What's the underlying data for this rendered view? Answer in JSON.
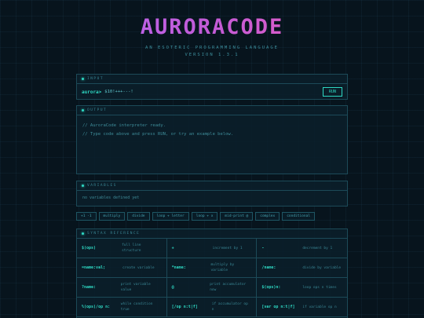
{
  "header": {
    "title": "AURORACODE",
    "tagline": "AN ESOTERIC PROGRAMMING LANGUAGE",
    "version": "VERSION 1.3.1"
  },
  "input": {
    "heading": "INPUT",
    "prompt": "aurora>",
    "value": "$10!+++---!",
    "run_label": "RUN"
  },
  "output": {
    "heading": "OUTPUT",
    "lines": [
      "// AuroraCode interpreter ready.",
      "// Type code above and press RUN, or try an example below."
    ]
  },
  "variables": {
    "heading": "VARIABLES",
    "empty_text": "no variables defined yet"
  },
  "examples": [
    "+1 -1",
    "multiply",
    "divide",
    "loop + letter",
    "loop + x",
    "mid-print @",
    "complex",
    "conditional"
  ],
  "reference": {
    "heading": "SYNTAX REFERENCE",
    "rows": [
      [
        {
          "op": "$(ops)",
          "desc": "full line structure"
        },
        {
          "op": "+",
          "desc": "increment by 1"
        },
        {
          "op": "-",
          "desc": "decrement by 1"
        }
      ],
      [
        {
          "op": "=name:val;",
          "desc": "create variable"
        },
        {
          "op": "*name:",
          "desc": "multiply by variable"
        },
        {
          "op": "/name:",
          "desc": "divide by variable"
        }
      ],
      [
        {
          "op": "?name:",
          "desc": "print variable value"
        },
        {
          "op": "@",
          "desc": "print accumulator now"
        },
        {
          "op": "$(ops)n:",
          "desc": "loop ops n times"
        }
      ],
      [
        {
          "op": "%(ops)/op n:",
          "desc": "while condition true"
        },
        {
          "op": "[/op n:t|f]",
          "desc": "if accumulator op n"
        },
        {
          "op": "[var op n:t|f]",
          "desc": "if variable op n"
        }
      ]
    ]
  }
}
